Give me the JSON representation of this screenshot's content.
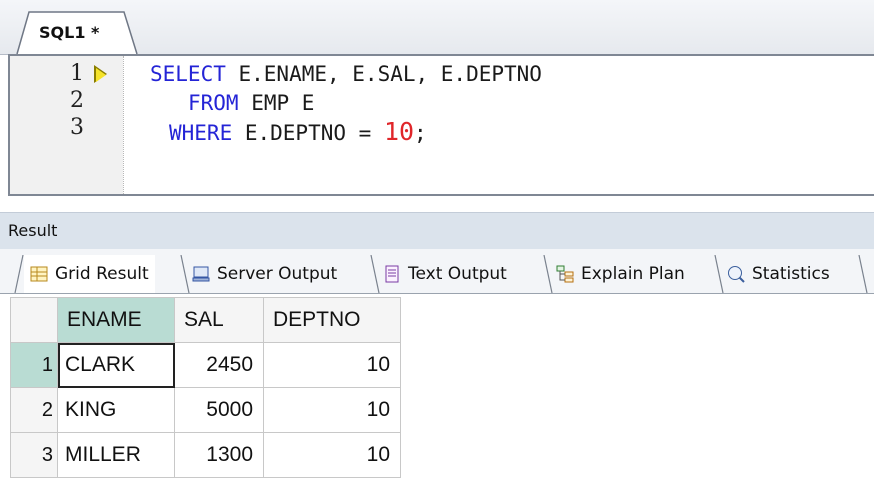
{
  "editor": {
    "tab_label": "SQL1 *",
    "line_numbers": [
      "1",
      "2",
      "3"
    ],
    "lines": [
      {
        "kw": "SELECT",
        "rest": " E.ENAME, E.SAL, E.DEPTNO",
        "num": "",
        "tail": ""
      },
      {
        "kw": "FROM",
        "rest": " EMP E",
        "num": "",
        "tail": ""
      },
      {
        "kw": "WHERE",
        "rest": " E.DEPTNO = ",
        "num": "10",
        "tail": ";"
      }
    ]
  },
  "result": {
    "title": "Result",
    "tabs": [
      {
        "label": "Grid Result",
        "icon": "grid-icon",
        "active": true
      },
      {
        "label": "Server Output",
        "icon": "server-output-icon",
        "active": false
      },
      {
        "label": "Text Output",
        "icon": "text-output-icon",
        "active": false
      },
      {
        "label": "Explain Plan",
        "icon": "explain-plan-icon",
        "active": false
      },
      {
        "label": "Statistics",
        "icon": "statistics-icon",
        "active": false
      }
    ],
    "columns": [
      "ENAME",
      "SAL",
      "DEPTNO"
    ],
    "rows": [
      {
        "num": "1",
        "ename": "CLARK",
        "sal": "2450",
        "deptno": "10"
      },
      {
        "num": "2",
        "ename": "KING",
        "sal": "5000",
        "deptno": "10"
      },
      {
        "num": "3",
        "ename": "MILLER",
        "sal": "1300",
        "deptno": "10"
      }
    ]
  },
  "colors": {
    "keyword": "#2424d6",
    "number_literal": "#e0262a",
    "selection": "#b9dcd3",
    "current_line_marker": "#f5e32a"
  }
}
